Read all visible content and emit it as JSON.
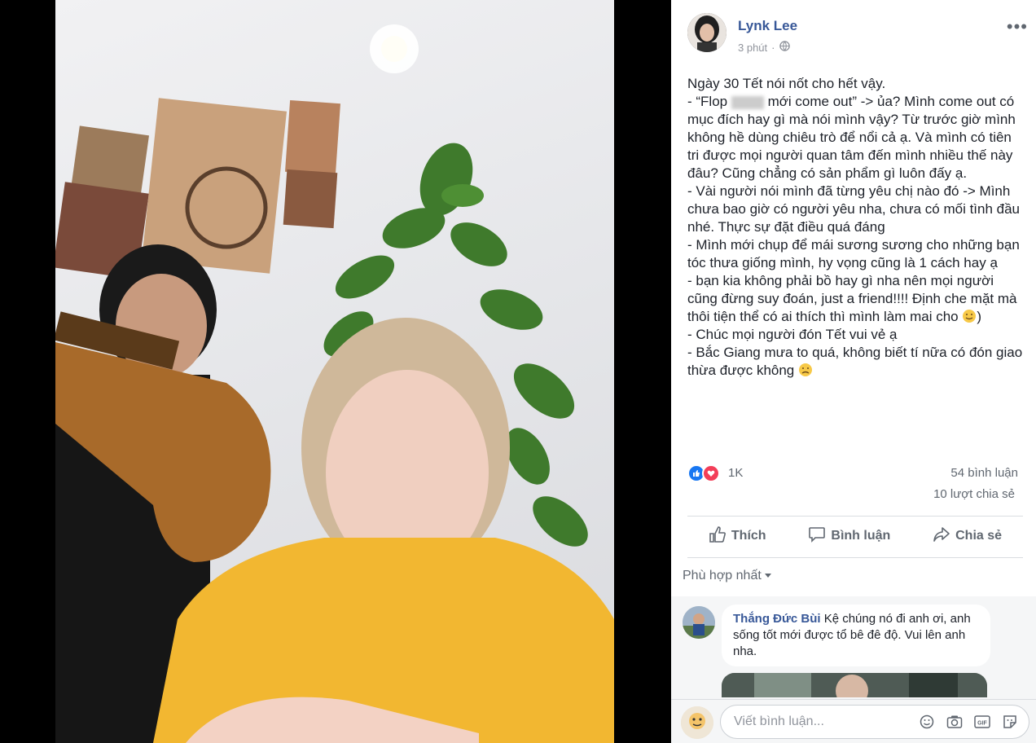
{
  "post": {
    "author": "Lynk Lee",
    "time": "3 phút",
    "paragraphs": [
      "Ngày 30 Tết nói nốt cho hết vậy.",
      "- “Flop",
      "mới come out” -> ủa? Mình come out có mục đích hay gì mà nói mình vậy? Từ trước giờ mình không hề dùng chiêu trò để nổi cả ạ. Và mình có tiên tri được mọi người quan tâm đến mình nhiều thế này đâu? Cũng chẳng có sản phẩm gì luôn đấy ạ.",
      "- Vài người nói mình đã từng yêu chị nào đó -> Mình chưa bao giờ có người yêu nha, chưa có mối tình đầu nhé. Thực sự đặt điều quá đáng",
      "- Mình mới chụp để mái sương sương cho những bạn tóc thưa giống mình, hy vọng cũng là 1 cách hay ạ",
      "- bạn kia không phải bồ hay gì nha nên mọi người cũng đừng suy đoán, just a friend!!!! Định che mặt mà thôi tiện thể có ai thích thì mình làm mai cho",
      ")",
      "- Chúc mọi người đón Tết vui vẻ ạ",
      "- Bắc Giang mưa to quá, không biết tí nữa có đón giao thừa được không"
    ]
  },
  "reactions": {
    "count": "1K",
    "comments": "54 bình luận",
    "shares": "10 lượt chia sẻ"
  },
  "actions": {
    "like": "Thích",
    "comment": "Bình luận",
    "share": "Chia sẻ"
  },
  "sort_label": "Phù hợp nhất",
  "comment": {
    "author": "Thắng Đức Bùi",
    "text": "Kệ chúng nó đi anh ơi, anh sống tốt mới được tổ bê đê độ. Vui lên anh nha."
  },
  "composer": {
    "placeholder": "Viết bình luận..."
  },
  "icons": {
    "globe": "globe-icon",
    "more": "more-icon",
    "like": "thumbs-up-icon",
    "comment": "comment-bubble-icon",
    "share": "share-arrow-icon",
    "emoji": "emoji-icon",
    "camera": "camera-icon",
    "gif": "gif-icon",
    "sticker": "sticker-icon"
  },
  "colors": {
    "link": "#385898",
    "like": "#1877f2",
    "love": "#f33e58",
    "sweater": "#f2b731"
  }
}
